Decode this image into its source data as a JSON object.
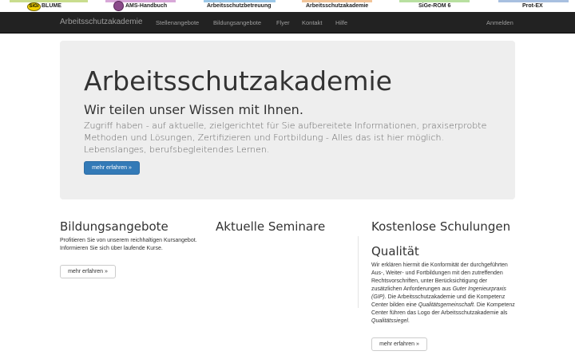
{
  "product_strip": [
    {
      "label": "BLUME",
      "badge": "SiGi",
      "color": "#c9dd8e"
    },
    {
      "label": "AMS-Handbuch",
      "color": "#d8a8d8"
    },
    {
      "label": "Arbeitsschutzbetreuung",
      "color": "#9cc8e8"
    },
    {
      "label": "Arbeitsschutzakademie",
      "color": "#f2c59a"
    },
    {
      "label": "SiGe-ROM 6",
      "color": "#b8e0a0"
    },
    {
      "label": "Prot-EX",
      "color": "#a8c0e0"
    }
  ],
  "navbar": {
    "brand": "Arbeitsschutzakademie",
    "links": [
      "Stellenangebote",
      "Bildungsangebote",
      "Flyer",
      "Kontakt",
      "Hilfe"
    ],
    "login": "Anmelden"
  },
  "jumbotron": {
    "title": "Arbeitsschutzakademie",
    "subtitle": "Wir teilen unser Wissen mit Ihnen.",
    "lead": "Zugriff haben - auf aktuelle, zielgerichtet für Sie aufbereitete Informationen, praxiserprobte Methoden und Lösungen, Zertifizieren und Fortbildung - Alles das ist hier möglich. Lebenslanges, berufsbegleitendes Lernen.",
    "button": "mehr erfahren »"
  },
  "columns": {
    "bildung": {
      "title": "Bildungsangebote",
      "text": "Profitieren Sie von unserem reichhaltigen Kursangebot. Informieren Sie sich über laufende Kurse.",
      "button": "mehr erfahren »"
    },
    "seminare": {
      "title": "Aktuelle Seminare"
    },
    "schulungen": {
      "title": "Kostenlose Schulungen",
      "subtitle": "Qualität",
      "text_parts": [
        "Wir erklären hiermit die Konformität der durchgeführten Aus-, Weiter- und Fortbildungen mit den zutreffenden Rechtsvorschriften, unter Berücksichtigung der zusätzlichen Anforderungen aus ",
        "Guter Ingenieurpraxis (GIP)",
        ". Die Arbeitsschutzakademie und die Kompetenz Center bilden eine ",
        "Qualitätsgemeinschaft",
        ". Die Kompetenz Center führen das Logo der Arbeitsschutzakademie als ",
        "Qualitätssiegel",
        "."
      ],
      "button": "mehr erfahren »"
    }
  }
}
